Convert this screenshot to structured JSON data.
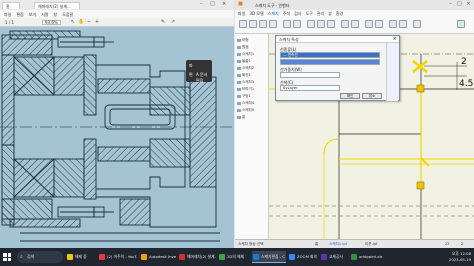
{
  "pdf": {
    "tab_title": "해머래치(2) 설계...",
    "menu": [
      "파일",
      "편집",
      "보기",
      "서명",
      "창",
      "도움말"
    ],
    "page_current": "1",
    "page_total": "/ 1",
    "zoom": "93.6%",
    "float_tools": {
      "pen_label": "파",
      "edit_label": "편",
      "sign_label": "A 문서 편집"
    }
  },
  "cad": {
    "window_title": "스케치 도구 · 인벤터",
    "ribbon_tabs": [
      "파일",
      "3D 모델",
      "스케치",
      "주석",
      "검사",
      "도구",
      "관리",
      "뷰",
      "환경"
    ],
    "tree_items": [
      "모형",
      "원점",
      "스케치1",
      "돌출1",
      "스케치2",
      "회전1",
      "스케치3",
      "모따기1",
      "구멍1",
      "스케치4",
      "스케치5",
      "끝"
    ],
    "dialog": {
      "title": "스케치 특성",
      "row1_label": "선종류(L)",
      "row1_value": "— 연속선",
      "row2_label": "선가중치(W)",
      "row3_label": "선색(C)",
      "row3_value": "ByLayer",
      "ok_label": "확인",
      "cancel_label": "취소"
    },
    "dimensions": {
      "d1": "2",
      "d2": "4.5"
    },
    "status": [
      "스케치 형상 선택",
      "22",
      "2"
    ],
    "bottom_tabs": [
      "홈",
      "스케치1.ipt",
      "이웃.ipt"
    ]
  },
  "taskbar": {
    "search_placeholder": "검색",
    "apps": [
      {
        "label": "해제 중",
        "color": "#f1c40f"
      },
      {
        "label": "(2) 아주이 - YouT...",
        "color": "#e53935"
      },
      {
        "label": "Autodesk Inventor",
        "color": "#f39c12"
      },
      {
        "label": "해머래치(2) 설계...",
        "color": "#d32f2f"
      },
      {
        "label": "2D의 체제",
        "color": "#43a047"
      },
      {
        "label": "스케치편집 - C",
        "color": "#1976d2"
      },
      {
        "label": "ZOOM 회의",
        "color": "#2d8cff"
      },
      {
        "label": "교체공사",
        "color": "#5e35b1"
      },
      {
        "label": "orldpaint.xls",
        "color": "#388e3c"
      }
    ],
    "time": "오후 12:08",
    "date": "2023-05-19"
  },
  "colors": {
    "drawing_bg": "#a4c4d3",
    "hatch_line": "#1d2d3d",
    "sketch_yellow": "#f2d600"
  }
}
